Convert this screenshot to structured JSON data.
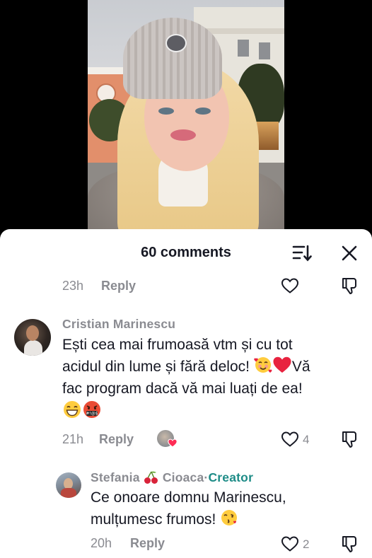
{
  "sheet": {
    "title": "60 comments"
  },
  "top_comment": {
    "time": "23h",
    "reply_label": "Reply"
  },
  "comment1": {
    "author": "Cristian Marinescu",
    "text_line1": "Ești cea mai frumoasă vtm și cu tot",
    "text_line2": "acidul din lume și fără deloc!",
    "text_line3_after_emoji": "Vă",
    "text_line3": "fac program dacă vă mai luați de ea!",
    "time": "21h",
    "reply_label": "Reply",
    "like_count": "4"
  },
  "reply1": {
    "author_first": "Stefania",
    "author_last": "Cioaca",
    "separator": "·",
    "creator_badge": "Creator",
    "text_line1": "Ce onoare domnu Marinescu,",
    "text_line2": "mulțumesc frumos!",
    "time": "20h",
    "reply_label": "Reply",
    "like_count": "2"
  },
  "icons": {
    "sort": "sort-icon",
    "close": "close-icon",
    "like": "heart-outline-icon",
    "dislike": "thumbs-down-icon"
  },
  "colors": {
    "sheet_bg": "#ffffff",
    "text_primary": "#161823",
    "text_secondary": "#8a8b91",
    "creator_accent": "#1e8c87"
  }
}
